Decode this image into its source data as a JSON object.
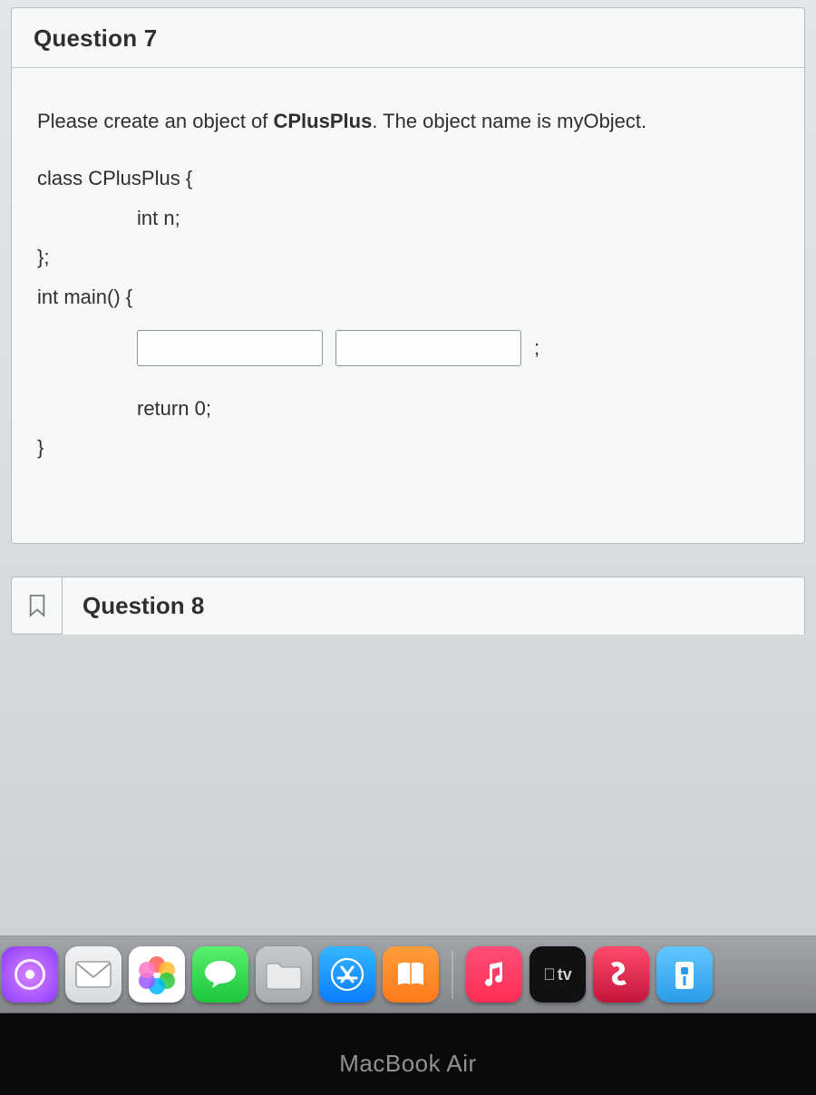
{
  "question7": {
    "title": "Question 7",
    "prompt_prefix": "Please create an object of ",
    "prompt_bold": "CPlusPlus",
    "prompt_suffix": ". The object name is myObject.",
    "code": {
      "l1": "class CPlusPlus {",
      "l2": "int n;",
      "l3": "};",
      "l4": "int main() {",
      "semi": ";",
      "l5": "return 0;",
      "l6": "}"
    },
    "blank1_value": "",
    "blank2_value": ""
  },
  "question8": {
    "title": "Question 8"
  },
  "dock": {
    "tv_label": "tv"
  },
  "device_label": "MacBook Air"
}
